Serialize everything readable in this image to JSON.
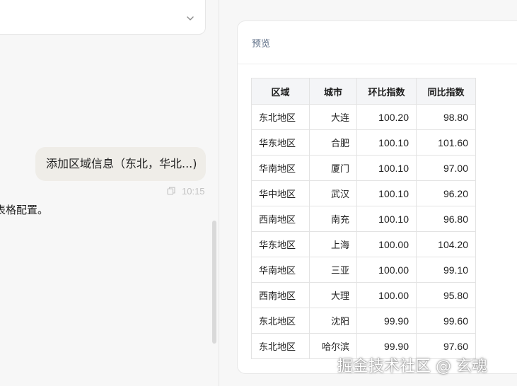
{
  "chat": {
    "user_message": "添加区域信息（东北，华北...)",
    "message_time": "10:15",
    "assistant_text_fragment": "表格配置。"
  },
  "preview": {
    "title": "预览",
    "table": {
      "headers": [
        "区域",
        "城市",
        "环比指数",
        "同比指数"
      ],
      "rows": [
        [
          "东北地区",
          "大连",
          "100.20",
          "98.80"
        ],
        [
          "华东地区",
          "合肥",
          "100.10",
          "101.60"
        ],
        [
          "华南地区",
          "厦门",
          "100.10",
          "97.00"
        ],
        [
          "华中地区",
          "武汉",
          "100.10",
          "96.20"
        ],
        [
          "西南地区",
          "南充",
          "100.10",
          "96.80"
        ],
        [
          "华东地区",
          "上海",
          "100.00",
          "104.20"
        ],
        [
          "华南地区",
          "三亚",
          "100.00",
          "99.10"
        ],
        [
          "西南地区",
          "大理",
          "100.00",
          "95.80"
        ],
        [
          "东北地区",
          "沈阳",
          "99.90",
          "99.60"
        ],
        [
          "东北地区",
          "哈尔滨",
          "99.90",
          "97.60"
        ]
      ]
    }
  },
  "watermark": "掘金技术社区 @ 玄魂",
  "icons": {
    "dropdown": "chevron-down-icon",
    "copy": "copy-icon"
  }
}
